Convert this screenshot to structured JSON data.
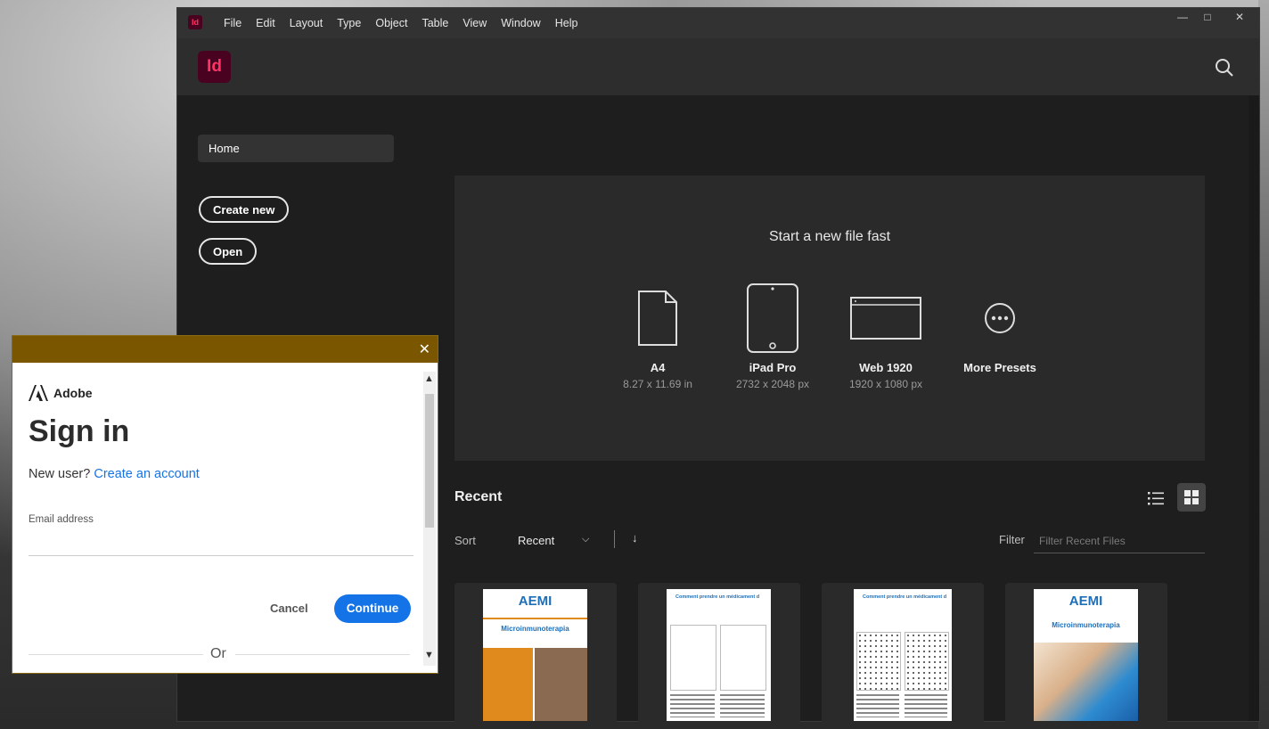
{
  "menubar": {
    "app_icon": "Id",
    "menus": [
      "File",
      "Edit",
      "Layout",
      "Type",
      "Object",
      "Table",
      "View",
      "Window",
      "Help"
    ],
    "window_controls": [
      "minimize-icon",
      "maximize-icon",
      "close-icon"
    ]
  },
  "header": {
    "logo": "Id",
    "search_icon": "search-icon"
  },
  "sidebar": {
    "home": "Home",
    "create_new": "Create new",
    "open": "Open"
  },
  "start": {
    "title": "Start a new file fast",
    "presets": [
      {
        "name": "A4",
        "size": "8.27 x 11.69 in",
        "icon": "document-icon"
      },
      {
        "name": "iPad Pro",
        "size": "2732 x 2048 px",
        "icon": "tablet-icon"
      },
      {
        "name": "Web 1920",
        "size": "1920 x 1080 px",
        "icon": "browser-window-icon"
      },
      {
        "name": "More Presets",
        "size": "",
        "icon": "more-icon"
      }
    ]
  },
  "recent": {
    "title": "Recent",
    "sort_label": "Sort",
    "sort_value": "Recent",
    "filter_label": "Filter",
    "filter_placeholder": "Filter Recent Files",
    "thumbnails": [
      {
        "heading": "AEMI",
        "subtitle": "Microinmunoterapia"
      },
      {
        "heading": "Comment prendre un médicament d",
        "subtitle": ""
      },
      {
        "heading": "Comment prendre un médicament d",
        "subtitle": ""
      },
      {
        "heading": "AEMI",
        "subtitle": "Microinmunoterapia"
      }
    ]
  },
  "signin": {
    "brand": "Adobe",
    "title": "Sign in",
    "new_user": "New user?",
    "create_account": "Create an account",
    "email_label": "Email address",
    "email_value": "",
    "cancel": "Cancel",
    "continue": "Continue",
    "or": "Or"
  },
  "colors": {
    "accent": "#1473e6",
    "indesign": "#ff3366",
    "dialog_bar": "#7a5600"
  }
}
